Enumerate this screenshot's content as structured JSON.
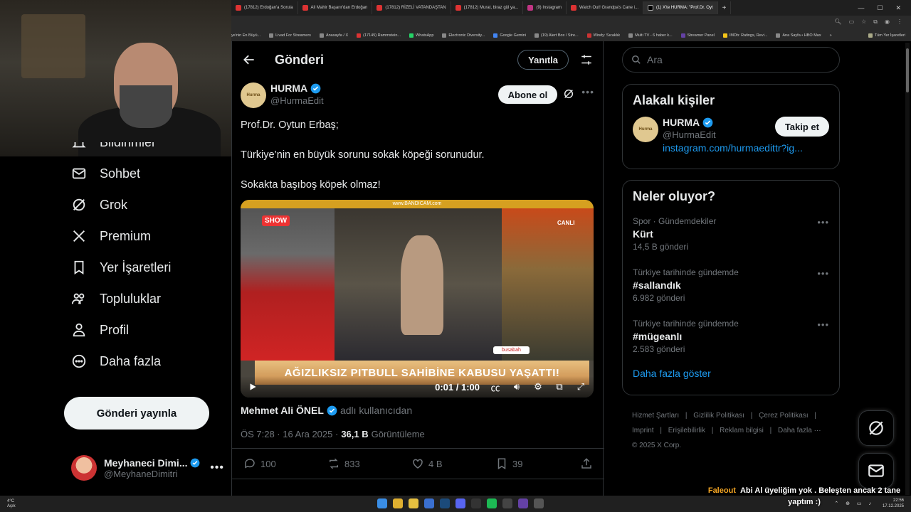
{
  "browser": {
    "tabs": [
      {
        "label": "(17812) Erdoğan'a Sorula",
        "active": false
      },
      {
        "label": "Ali Mahir Başarır'dan Erdoğan",
        "active": false
      },
      {
        "label": "(17812) RİZELİ VATANDAŞTAN",
        "active": false
      },
      {
        "label": "(17812) Murat, biraz gül ya...",
        "active": false
      },
      {
        "label": "(9) Instagram",
        "active": false
      },
      {
        "label": "Watch Out! Grandpa's Cane i...",
        "active": false
      },
      {
        "label": "(1) X'te HURMA: \"Prof.Dr. Oyt",
        "active": true
      }
    ],
    "new_tab": "+",
    "bookmarks": [
      "ye'nin En Büyü...",
      "Livad For Streamers",
      "Anasayfa / X",
      "(17145) Rammstein...",
      "WhatsApp",
      "Electronic Diversity...",
      "Google Gemini",
      "(19) Alert Box / Stre...",
      "Windy: Sıcaklık",
      "Multi TV - 6 haber k...",
      "Streamer Panel",
      "IMDb: Ratings, Revi...",
      "Ana Sayfa • HBO Max"
    ],
    "bookmarks_more": "»",
    "bookmarks_all": "Tüm Yer İşaretleri"
  },
  "nav": {
    "items": [
      {
        "label": "Bildirimler",
        "icon": "bell-icon"
      },
      {
        "label": "Sohbet",
        "icon": "mail-icon"
      },
      {
        "label": "Grok",
        "icon": "grok-icon"
      },
      {
        "label": "Premium",
        "icon": "x-logo-icon"
      },
      {
        "label": "Yer İşaretleri",
        "icon": "bookmark-icon"
      },
      {
        "label": "Topluluklar",
        "icon": "communities-icon"
      },
      {
        "label": "Profil",
        "icon": "profile-icon"
      },
      {
        "label": "Daha fazla",
        "icon": "more-circle-icon"
      }
    ],
    "post_button": "Gönderi yayınla",
    "account": {
      "name": "Meyhaneci Dimi...",
      "handle": "@MeyhaneDimitri",
      "more": "•••"
    }
  },
  "main": {
    "title": "Gönderi",
    "reply_button": "Yanıtla",
    "post": {
      "author_name": "HURMA",
      "author_handle": "@HurmaEdit",
      "avatar_text": "Hurma",
      "subscribe_button": "Abone ol",
      "more": "•••",
      "lines": [
        "Prof.Dr. Oytun Erbaş;",
        "Türkiye’nin en büyük sorunu sokak köpeği sorunudur.",
        "Sokakta başıboş köpek olmaz!"
      ],
      "video": {
        "top_strip": "www.BANDICAM.com",
        "channel": "SHOW",
        "live": "CANLI",
        "tag": "busabah",
        "banner": "AĞIZLIKSIZ PITBULL SAHİBİNE KABUSU YAŞATTI!",
        "time": "0:01 / 1:00"
      },
      "from_name": "Mehmet Ali ÖNEL",
      "from_suffix": "adlı kullanıcıdan",
      "time": "ÖS 7:28 · 16 Ara 2025 ·",
      "views": "36,1 B",
      "views_label": "Görüntüleme",
      "stats": {
        "replies": "100",
        "reposts": "833",
        "likes": "4 B",
        "bookmarks": "39"
      }
    }
  },
  "right": {
    "search_placeholder": "Ara",
    "related_title": "Alakalı kişiler",
    "related": {
      "name": "HURMA",
      "handle": "@HurmaEdit",
      "link": "instagram.com/hurmaedittr?ig...",
      "follow": "Takip et",
      "avatar_text": "Hurma"
    },
    "trends_title": "Neler oluyor?",
    "trends": [
      {
        "category": "Spor · Gündemdekiler",
        "name": "Kürt",
        "count": "14,5 B gönderi"
      },
      {
        "category": "Türkiye tarihinde gündemde",
        "name": "#sallandık",
        "count": "6.982 gönderi"
      },
      {
        "category": "Türkiye tarihinde gündemde",
        "name": "#mügeanlı",
        "count": "2.583 gönderi"
      }
    ],
    "trend_more": "•••",
    "show_more": "Daha fazla göster",
    "footer": {
      "line1": [
        "Hizmet Şartları",
        "|",
        "Gizlilik Politikası",
        "|",
        "Çerez Politikası",
        "|"
      ],
      "line2": [
        "Imprint",
        "|",
        "Erişilebilirlik",
        "|",
        "Reklam bilgisi",
        "|",
        "Daha fazla ···"
      ],
      "copyright": "© 2025 X Corp."
    }
  },
  "taskbar": {
    "weather_temp": "4°C",
    "weather_desc": "Açık",
    "time": "22:56",
    "date": "17.12.2025"
  },
  "stream_chat": {
    "user": "Faleout",
    "message": "Abi Al üyeliğim yok . Beleşten ancak 2 tane yaptım :)"
  },
  "colors": {
    "accent": "#1d9bf0",
    "background": "#000000",
    "border": "#2f3336",
    "muted": "#71767b"
  }
}
